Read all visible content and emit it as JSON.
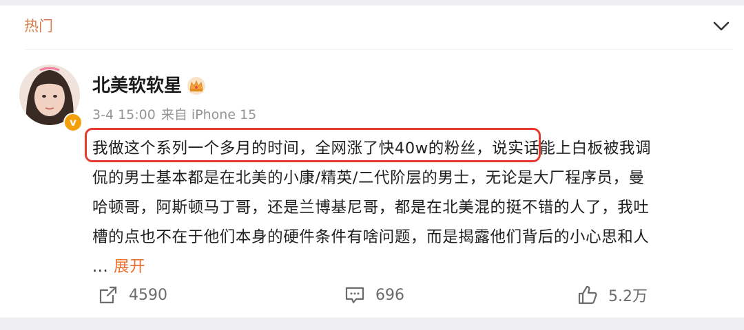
{
  "section": {
    "title": "热门"
  },
  "post": {
    "author": "北美软软星",
    "meta": {
      "time": "3-4 15:00",
      "source": "来自 iPhone 15"
    },
    "lines": [
      "我做这个系列一个多月的时间，全网涨了快40w的粉丝，说实话能上白板被我调",
      "侃的男士基本都是在北美的小康/精英/二代阶层的男士，无论是大厂程序员，曼",
      "哈顿哥，阿斯顿马丁哥，还是兰博基尼哥，都是在北美混的挺不错的人了，我吐",
      "槽的点也不在于他们本身的硬件条件有啥问题，而是揭露他们背后的小心思和人"
    ],
    "ellipsis": "...",
    "expand_label": "展开"
  },
  "badge": {
    "letter": "v"
  },
  "actions": {
    "repost": "4590",
    "comment": "696",
    "like": "5.2万"
  },
  "colors": {
    "highlight_box": "#e53a2d",
    "accent": "#e96f2e",
    "section_title": "#d67c49",
    "verified": "#f3a00c"
  },
  "icons": [
    "chevron-down-icon",
    "crown-icon",
    "repost-icon",
    "comment-icon",
    "like-icon"
  ]
}
